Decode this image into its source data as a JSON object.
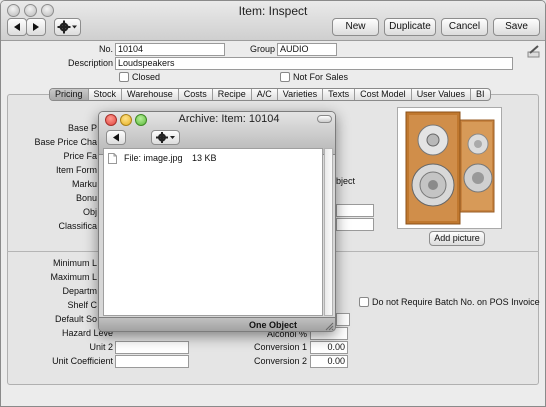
{
  "window": {
    "title": "Item: Inspect"
  },
  "toolbar": {
    "new_label": "New",
    "duplicate_label": "Duplicate",
    "cancel_label": "Cancel",
    "save_label": "Save"
  },
  "header": {
    "no_label": "No.",
    "no_value": "10104",
    "group_label": "Group",
    "group_value": "AUDIO",
    "description_label": "Description",
    "description_value": "Loudspeakers",
    "closed_label": "Closed",
    "not_for_sales_label": "Not For Sales"
  },
  "tabs": [
    {
      "label": "Pricing",
      "active": true
    },
    {
      "label": "Stock"
    },
    {
      "label": "Warehouse"
    },
    {
      "label": "Costs"
    },
    {
      "label": "Recipe"
    },
    {
      "label": "A/C"
    },
    {
      "label": "Varieties"
    },
    {
      "label": "Texts"
    },
    {
      "label": "Cost Model"
    },
    {
      "label": "User Values"
    },
    {
      "label": "BI"
    }
  ],
  "pricing": {
    "fields": [
      "Base P",
      "Base Price Cha",
      "Price Fa",
      "Item Form",
      "Marku",
      "Bonu",
      "Obj",
      "Classifica"
    ],
    "object_text": "bject"
  },
  "lower": {
    "left_labels": [
      "Minimum L",
      "Maximum L",
      "Departm",
      "Shelf C",
      "Default So",
      "Hazard Leve",
      "Unit 2",
      "Unit Coefficient"
    ],
    "batch_label": "Do not Require Batch No. on POS Invoice",
    "alcohol_label": "Alcohol %",
    "conversion1_label": "Conversion 1",
    "conversion1_value": "0.00",
    "conversion2_label": "Conversion 2",
    "conversion2_value": "0.00"
  },
  "picture": {
    "add_button": "Add picture"
  },
  "archive": {
    "title": "Archive: Item: 10104",
    "file_label": "File: image.jpg",
    "file_size": "13 KB",
    "footer": "One Object"
  },
  "colors": {
    "close_red": "#e0443e",
    "min_yellow": "#e5b021",
    "zoom_green": "#5bb83a"
  }
}
